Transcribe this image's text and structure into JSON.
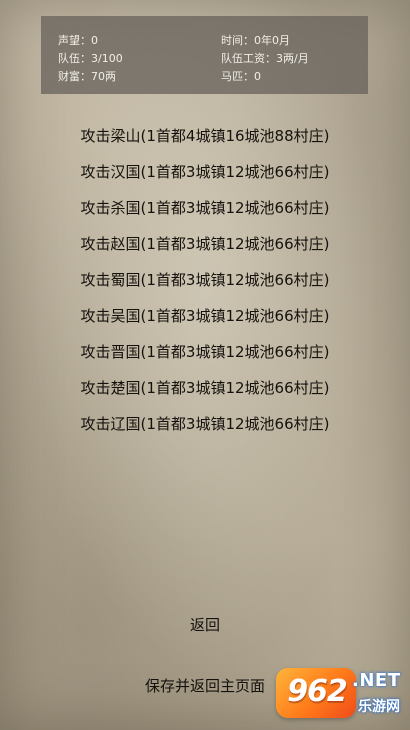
{
  "stats": {
    "reputation": {
      "label": "声望：",
      "value": "0"
    },
    "time": {
      "label": "时间：",
      "value": "0年0月"
    },
    "troops": {
      "label": "队伍：",
      "value": "3/100"
    },
    "wage": {
      "label": "队伍工资：",
      "value": "3两/月"
    },
    "wealth": {
      "label": "财富：",
      "value": "70两"
    },
    "horses": {
      "label": "马匹：",
      "value": "0"
    }
  },
  "attack_targets": [
    {
      "label": "攻击梁山(1首都4城镇16城池88村庄)"
    },
    {
      "label": "攻击汉国(1首都3城镇12城池66村庄)"
    },
    {
      "label": "攻击杀国(1首都3城镇12城池66村庄)"
    },
    {
      "label": "攻击赵国(1首都3城镇12城池66村庄)"
    },
    {
      "label": "攻击蜀国(1首都3城镇12城池66村庄)"
    },
    {
      "label": "攻击吴国(1首都3城镇12城池66村庄)"
    },
    {
      "label": "攻击晋国(1首都3城镇12城池66村庄)"
    },
    {
      "label": "攻击楚国(1首都3城镇12城池66村庄)"
    },
    {
      "label": "攻击辽国(1首都3城镇12城池66村庄)"
    }
  ],
  "buttons": {
    "back": "返回",
    "save_and_return": "保存并返回主页面"
  },
  "watermark": {
    "digits": "962",
    "net": ".NET",
    "site": "乐游网"
  },
  "colors": {
    "panel": "#69645d",
    "text": "#15120e",
    "panel_text": "#f2efe8",
    "badge": "#ff7a1a"
  }
}
